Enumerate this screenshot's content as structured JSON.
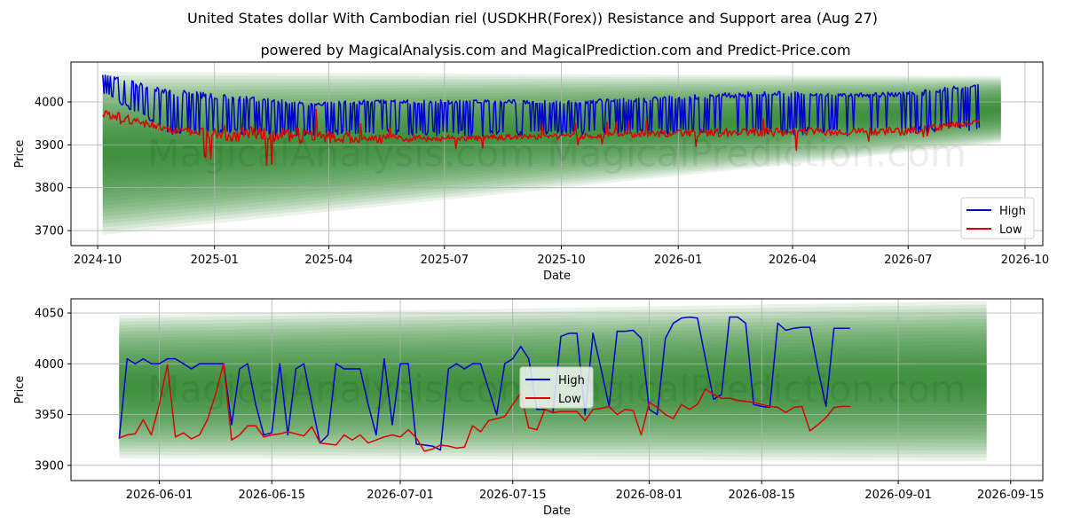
{
  "title": "United States dollar With Cambodian riel (USDKHR(Forex)) Resistance and Support area (Aug 27)",
  "subtitle": "powered by MagicalAnalysis.com and MagicalPrediction.com and Predict-Price.com",
  "watermarks": [
    "MagicalAnalysis.com",
    "MagicalPrediction.com"
  ],
  "colors": {
    "high": "#0000cc",
    "low": "#dd0000",
    "band": "#2e8b2e",
    "grid": "#b0b0b0"
  },
  "chart_data": [
    {
      "type": "line",
      "xlabel": "Date",
      "ylabel": "Price",
      "ylim": [
        3665,
        4093
      ],
      "xlim": [
        "2024-09-10",
        "2026-10-15"
      ],
      "x_ticks": [
        "2024-10",
        "2025-01",
        "2025-04",
        "2025-07",
        "2025-10",
        "2026-01",
        "2026-04",
        "2026-07",
        "2026-10"
      ],
      "y_ticks": [
        3700,
        3800,
        3900,
        4000
      ],
      "legend": {
        "position": "lower-right",
        "entries": [
          "High",
          "Low"
        ]
      },
      "grid": true,
      "band": {
        "x": [
          "2024-10-05",
          "2026-09-12"
        ],
        "upper": [
          4070,
          4060
        ],
        "lower": [
          3690,
          3905
        ]
      },
      "series": [
        {
          "name": "High",
          "x_start": "2024-10-05",
          "x_end": "2026-08-26",
          "avg": [
            4050,
            3960,
            3960,
            3955,
            3960,
            3965,
            3965,
            3965,
            3968,
            3970,
            3975,
            3975,
            3975,
            3990
          ],
          "top": [
            4065,
            4030,
            4015,
            4000,
            4005,
            4005,
            4005,
            4005,
            4010,
            4020,
            4025,
            4020,
            4025,
            4045
          ],
          "bottom": [
            4020,
            3925,
            3925,
            3920,
            3925,
            3920,
            3920,
            3925,
            3925,
            3920,
            3925,
            3920,
            3925,
            3935
          ]
        },
        {
          "name": "Low",
          "x_start": "2024-10-05",
          "x_end": "2026-08-26",
          "avg": [
            3975,
            3935,
            3925,
            3920,
            3915,
            3915,
            3918,
            3920,
            3925,
            3928,
            3930,
            3930,
            3932,
            3955
          ],
          "top": [
            4050,
            3960,
            3990,
            3990,
            3940,
            3940,
            3945,
            3950,
            3955,
            3960,
            3960,
            3960,
            3990,
            3975
          ],
          "bottom": [
            3965,
            3905,
            3840,
            3870,
            3860,
            3890,
            3895,
            3900,
            3905,
            3895,
            3880,
            3905,
            3915,
            3940
          ]
        }
      ]
    },
    {
      "type": "line",
      "xlabel": "Date",
      "ylabel": "Price",
      "ylim": [
        3885,
        4064
      ],
      "xlim": [
        "2026-05-21",
        "2026-09-19"
      ],
      "x_ticks": [
        "2026-06-01",
        "2026-06-15",
        "2026-07-01",
        "2026-07-15",
        "2026-08-01",
        "2026-08-15",
        "2026-09-01",
        "2026-09-15"
      ],
      "y_ticks": [
        3900,
        3950,
        4000,
        4050
      ],
      "legend": {
        "position": "center",
        "entries": [
          "High",
          "Low"
        ]
      },
      "grid": true,
      "band": {
        "x": [
          "2026-05-27",
          "2026-09-12"
        ],
        "upper": [
          4048,
          4062
        ],
        "lower": [
          3907,
          3904
        ]
      },
      "series": [
        {
          "name": "High",
          "x": [
            "2026-05-27",
            "2026-05-28",
            "2026-05-29",
            "2026-05-30",
            "2026-05-31",
            "2026-06-01",
            "2026-06-02",
            "2026-06-03",
            "2026-06-04",
            "2026-06-05",
            "2026-06-06",
            "2026-06-07",
            "2026-06-08",
            "2026-06-09",
            "2026-06-10",
            "2026-06-11",
            "2026-06-12",
            "2026-06-13",
            "2026-06-14",
            "2026-06-15",
            "2026-06-16",
            "2026-06-17",
            "2026-06-18",
            "2026-06-19",
            "2026-06-20",
            "2026-06-21",
            "2026-06-22",
            "2026-06-23",
            "2026-06-24",
            "2026-06-25",
            "2026-06-26",
            "2026-06-27",
            "2026-06-28",
            "2026-06-29",
            "2026-06-30",
            "2026-07-01",
            "2026-07-02",
            "2026-07-03",
            "2026-07-04",
            "2026-07-05",
            "2026-07-06",
            "2026-07-07",
            "2026-07-08",
            "2026-07-09",
            "2026-07-10",
            "2026-07-11",
            "2026-07-12",
            "2026-07-13",
            "2026-07-14",
            "2026-07-15",
            "2026-07-16",
            "2026-07-17",
            "2026-07-18",
            "2026-07-19",
            "2026-07-20",
            "2026-07-21",
            "2026-07-22",
            "2026-07-23",
            "2026-07-24",
            "2026-07-25",
            "2026-07-26",
            "2026-07-27",
            "2026-07-28",
            "2026-07-29",
            "2026-07-30",
            "2026-07-31",
            "2026-08-01",
            "2026-08-02",
            "2026-08-03",
            "2026-08-04",
            "2026-08-05",
            "2026-08-06",
            "2026-08-07",
            "2026-08-08",
            "2026-08-09",
            "2026-08-10",
            "2026-08-11",
            "2026-08-12",
            "2026-08-13",
            "2026-08-14",
            "2026-08-15",
            "2026-08-16",
            "2026-08-17",
            "2026-08-18",
            "2026-08-19",
            "2026-08-20",
            "2026-08-21",
            "2026-08-22",
            "2026-08-23",
            "2026-08-24",
            "2026-08-25",
            "2026-08-26"
          ],
          "values": [
            3926,
            4005,
            4000,
            4005,
            4000,
            4000,
            4005,
            4005,
            4000,
            3995,
            4000,
            4000,
            4000,
            4000,
            3940,
            3995,
            4000,
            3960,
            3930,
            3932,
            4000,
            3930,
            3995,
            4000,
            3960,
            3922,
            3930,
            4000,
            3995,
            3995,
            3995,
            3960,
            3930,
            4005,
            3940,
            4000,
            4000,
            3921,
            3920,
            3919,
            3915,
            3995,
            4000,
            3995,
            4000,
            4000,
            3975,
            3950,
            4000,
            4005,
            4017,
            4005,
            3955,
            3955,
            3952,
            4027,
            4030,
            4030,
            3950,
            4030,
            3995,
            3958,
            4032,
            4032,
            4033,
            4025,
            3955,
            3950,
            4025,
            4040,
            4045,
            4046,
            4045,
            4005,
            3965,
            3970,
            4046,
            4046,
            4040,
            3960,
            3958,
            3957,
            4040,
            4033,
            4035,
            4036,
            4036,
            3995,
            3958,
            4035,
            4035,
            4035
          ]
        },
        {
          "name": "Low",
          "x": [
            "2026-05-27",
            "2026-05-28",
            "2026-05-29",
            "2026-05-30",
            "2026-05-31",
            "2026-06-01",
            "2026-06-02",
            "2026-06-03",
            "2026-06-04",
            "2026-06-05",
            "2026-06-06",
            "2026-06-07",
            "2026-06-08",
            "2026-06-09",
            "2026-06-10",
            "2026-06-11",
            "2026-06-12",
            "2026-06-13",
            "2026-06-14",
            "2026-06-15",
            "2026-06-16",
            "2026-06-17",
            "2026-06-18",
            "2026-06-19",
            "2026-06-20",
            "2026-06-21",
            "2026-06-22",
            "2026-06-23",
            "2026-06-24",
            "2026-06-25",
            "2026-06-26",
            "2026-06-27",
            "2026-06-28",
            "2026-06-29",
            "2026-06-30",
            "2026-07-01",
            "2026-07-02",
            "2026-07-03",
            "2026-07-04",
            "2026-07-05",
            "2026-07-06",
            "2026-07-07",
            "2026-07-08",
            "2026-07-09",
            "2026-07-10",
            "2026-07-11",
            "2026-07-12",
            "2026-07-13",
            "2026-07-14",
            "2026-07-15",
            "2026-07-16",
            "2026-07-17",
            "2026-07-18",
            "2026-07-19",
            "2026-07-20",
            "2026-07-21",
            "2026-07-22",
            "2026-07-23",
            "2026-07-24",
            "2026-07-25",
            "2026-07-26",
            "2026-07-27",
            "2026-07-28",
            "2026-07-29",
            "2026-07-30",
            "2026-07-31",
            "2026-08-01",
            "2026-08-02",
            "2026-08-03",
            "2026-08-04",
            "2026-08-05",
            "2026-08-06",
            "2026-08-07",
            "2026-08-08",
            "2026-08-09",
            "2026-08-10",
            "2026-08-11",
            "2026-08-12",
            "2026-08-13",
            "2026-08-14",
            "2026-08-15",
            "2026-08-16",
            "2026-08-17",
            "2026-08-18",
            "2026-08-19",
            "2026-08-20",
            "2026-08-21",
            "2026-08-22",
            "2026-08-23",
            "2026-08-24",
            "2026-08-25",
            "2026-08-26"
          ],
          "values": [
            3927,
            3930,
            3931,
            3945,
            3930,
            3960,
            3999,
            3928,
            3932,
            3926,
            3930,
            3945,
            3970,
            4000,
            3925,
            3930,
            3939,
            3939,
            3928,
            3930,
            3931,
            3933,
            3931,
            3929,
            3938,
            3922,
            3921,
            3920,
            3930,
            3925,
            3930,
            3922,
            3925,
            3928,
            3930,
            3928,
            3935,
            3927,
            3914,
            3916,
            3920,
            3919,
            3917,
            3918,
            3939,
            3933,
            3944,
            3946,
            3948,
            3960,
            3971,
            3937,
            3935,
            3955,
            3952,
            3953,
            3953,
            3953,
            3944,
            3955,
            3956,
            3958,
            3950,
            3955,
            3954,
            3930,
            3962,
            3957,
            3950,
            3946,
            3960,
            3955,
            3960,
            3975,
            3970,
            3966,
            3966,
            3964,
            3963,
            3962,
            3960,
            3958,
            3957,
            3952,
            3957,
            3958,
            3934,
            3940,
            3947,
            3957,
            3958,
            3958
          ]
        }
      ]
    }
  ]
}
